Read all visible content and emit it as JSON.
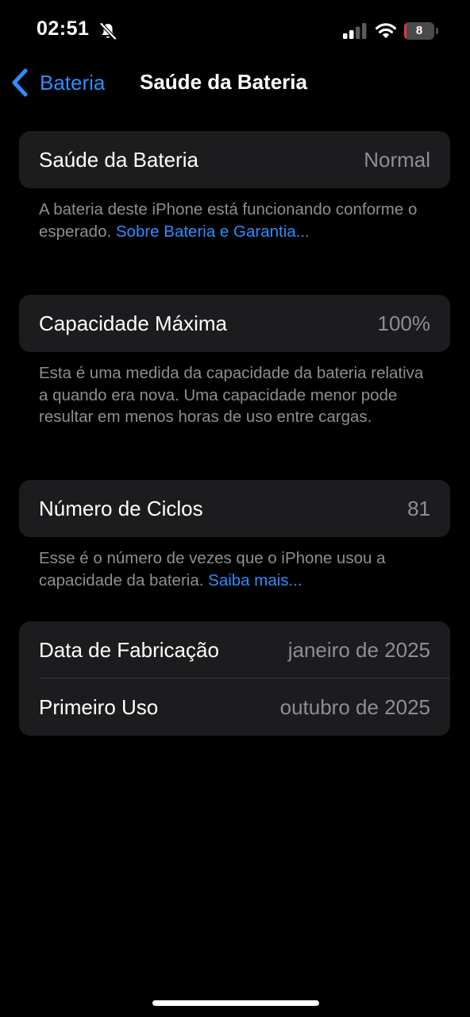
{
  "status_bar": {
    "time": "02:51",
    "battery_level": "8",
    "battery_fraction": 0.08,
    "battery_color": "#e5363b",
    "icons": [
      "bell-slash-icon",
      "cellular-signal-icon",
      "wifi-icon",
      "battery-icon"
    ]
  },
  "nav": {
    "back_label": "Bateria",
    "back_icon": "chevron-left-icon",
    "title": "Saúde da Bateria"
  },
  "health": {
    "label": "Saúde da Bateria",
    "value": "Normal",
    "footnote_text": "A bateria deste iPhone está funcionando conforme o esperado. ",
    "footnote_link": "Sobre Bateria e Garantia..."
  },
  "capacity": {
    "label": "Capacidade Máxima",
    "value": "100%",
    "footnote_text": "Esta é uma medida da capacidade da bateria relativa a quando era nova. Uma capacidade menor pode resultar em menos horas de uso entre cargas."
  },
  "cycles": {
    "label": "Número de Ciclos",
    "value": "81",
    "footnote_text": "Esse é o número de vezes que o iPhone usou a capacidade da bateria. ",
    "footnote_link": "Saiba mais..."
  },
  "dates": {
    "manufacture_label": "Data de Fabricação",
    "manufacture_value": "janeiro de 2025",
    "first_use_label": "Primeiro Uso",
    "first_use_value": "outubro de 2025"
  },
  "colors": {
    "background": "#000000",
    "cell_background": "#1c1c1e",
    "accent_link": "#2f8cff",
    "secondary_text": "#8e8e93",
    "battery_low": "#e5363b"
  }
}
